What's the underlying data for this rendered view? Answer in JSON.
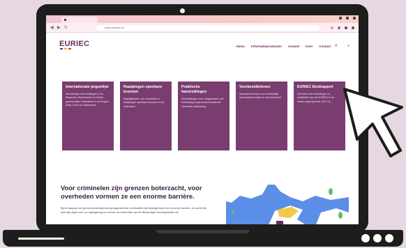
{
  "browser": {
    "url": "https://euriec.eu"
  },
  "site": {
    "logo": "EURIEC",
    "nav": [
      "Home",
      "Informatieproducten",
      "Actueel",
      "Over",
      "Contact"
    ],
    "nav_extra": [
      "≡",
      "⌕"
    ]
  },
  "cards": [
    {
      "title": "Internationale jargonlijst",
      "text": "Woordenlijst met vertalingen in de Belgische, Nederlandse en Duitse gezamenlijke criminaliteit in het Engels, Duits, Frans en Nederlands."
    },
    {
      "title": "Raadplegen openbare bronnen",
      "text": "Mogelijkheden van overheden in raadplegen openbare bronnen in het buitenland"
    },
    {
      "title": "Praktische handreikingen",
      "text": "Handreikingen voor vraagstukken met betrekking tot grensoverschrijdende informatie-uitwisseling"
    },
    {
      "title": "Voorbeeldbrieven",
      "text": "Standaard formats voor schriftelijke informatieverzoeken in het buitenland"
    },
    {
      "title": "EURIEC Eindrapport",
      "text": "Overzicht van bevindingen en activiteiten van het EURIEC in de eerste projectperiode (1/8 '21)"
    }
  ],
  "intro": {
    "headline": "Voor criminelen zijn grenzen boterzacht, voor overheden vormen ze een enorme barrière.",
    "paragraph": "Bij de aanpak van grensoverschrijdende georganiseerde criminaliteit zijn landsgrenzen een enorme barrière. Zo wordt elk land zijn eigen wet- en regelgeving en kunnen de informatie van de Belduurlijke bevoegdheden en"
  },
  "colors": {
    "brand": "#6b2b62",
    "card": "#7a3d70",
    "map_blue": "#5b8ee6",
    "map_green": "#5cc06a",
    "map_yellow": "#f2c94c"
  }
}
